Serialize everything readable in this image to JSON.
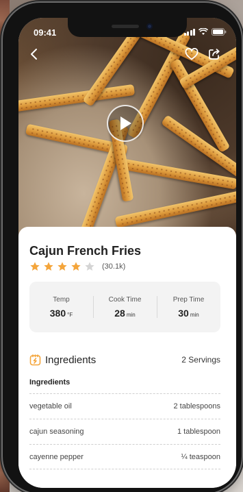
{
  "status": {
    "time": "09:41"
  },
  "hero": {
    "icons": {
      "back": "chevron-left-icon",
      "favorite": "heart-icon",
      "share": "share-icon",
      "play": "play-icon"
    }
  },
  "recipe": {
    "title": "Cajun French Fries",
    "rating_value": 4,
    "rating_max": 5,
    "rating_count": "(30.1k)",
    "star_color": "#f4a53b",
    "star_empty_color": "#d4d4d4"
  },
  "stats": [
    {
      "label": "Temp",
      "value": "380",
      "unit": "°F"
    },
    {
      "label": "Cook Time",
      "value": "28",
      "unit": "min"
    },
    {
      "label": "Prep Time",
      "value": "30",
      "unit": "min"
    }
  ],
  "ingredients": {
    "header": "Ingredients",
    "servings": "2 Servings",
    "subheader": "Ingredients",
    "accent": "#f4a53b",
    "items": [
      {
        "name": "vegetable oil",
        "amount": "2 tablespoons"
      },
      {
        "name": "cajun seasoning",
        "amount": "1 tablespoon"
      },
      {
        "name": "cayenne pepper",
        "amount": "¼ teaspoon"
      }
    ]
  }
}
